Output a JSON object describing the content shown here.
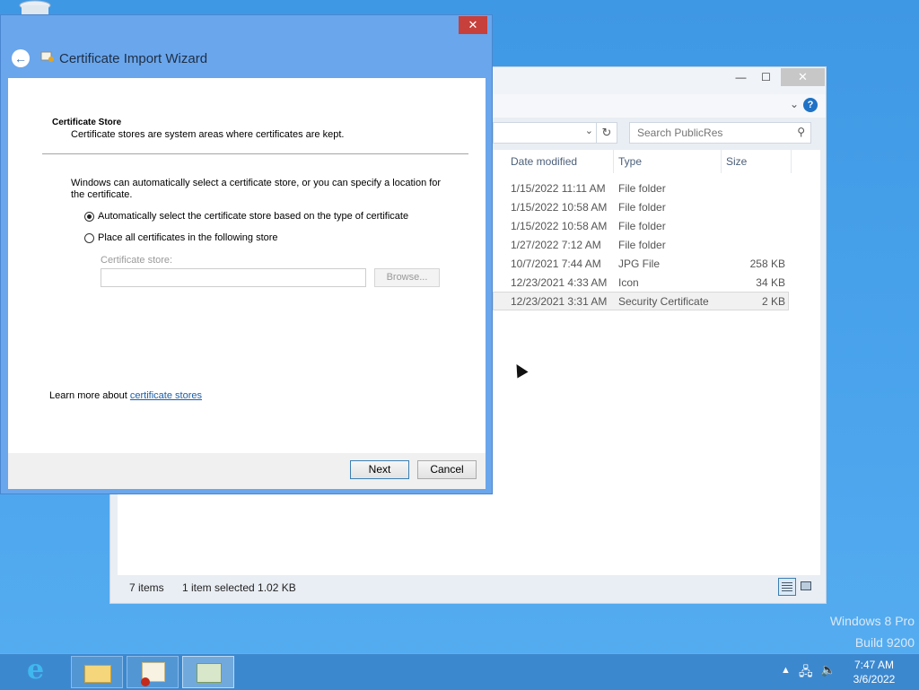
{
  "explorer": {
    "search_placeholder": "Search PublicRes",
    "columns": {
      "date": "Date modified",
      "type": "Type",
      "size": "Size"
    },
    "rows": [
      {
        "date": "1/15/2022 11:11 AM",
        "type": "File folder",
        "size": ""
      },
      {
        "date": "1/15/2022 10:58 AM",
        "type": "File folder",
        "size": ""
      },
      {
        "date": "1/15/2022 10:58 AM",
        "type": "File folder",
        "size": ""
      },
      {
        "date": "1/27/2022 7:12 AM",
        "type": "File folder",
        "size": ""
      },
      {
        "date": "10/7/2021 7:44 AM",
        "type": "JPG File",
        "size": "258 KB"
      },
      {
        "date": "12/23/2021 4:33 AM",
        "type": "Icon",
        "size": "34 KB"
      },
      {
        "date": "12/23/2021 3:31 AM",
        "type": "Security Certificate",
        "size": "2 KB"
      }
    ],
    "status_items": "7 items",
    "status_selected": "1 item selected  1.02 KB"
  },
  "wizard": {
    "title": "Certificate Import Wizard",
    "heading": "Certificate Store",
    "subheading": "Certificate stores are system areas where certificates are kept.",
    "description": "Windows can automatically select a certificate store, or you can specify a location for the certificate.",
    "option_auto": "Automatically select the certificate store based on the type of certificate",
    "option_manual": "Place all certificates in the following store",
    "store_label": "Certificate store:",
    "store_value": "",
    "browse_label": "Browse...",
    "learn_prefix": "Learn more about ",
    "learn_link": "certificate stores",
    "next_label": "Next",
    "cancel_label": "Cancel"
  },
  "watermark": {
    "line1": "Windows 8 Pro",
    "line2": "Build 9200"
  },
  "clock": {
    "time": "7:47 AM",
    "date": "3/6/2022"
  }
}
